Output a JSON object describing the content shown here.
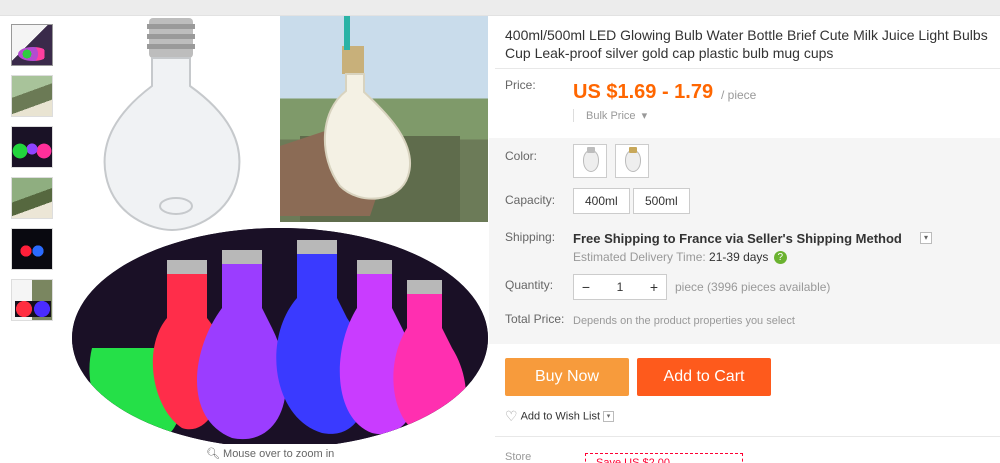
{
  "product": {
    "title": "400ml/500ml LED Glowing Bulb Water Bottle Brief Cute Milk Juice Light Bulbs Cup Leak-proof silver gold cap plastic bulb mug cups",
    "mouse_hint": "Mouse over to zoom in"
  },
  "price": {
    "label": "Price:",
    "value": "US $1.69 - 1.79",
    "unit": "/ piece",
    "bulk": "Bulk Price"
  },
  "color": {
    "label": "Color:"
  },
  "capacity": {
    "label": "Capacity:",
    "options": [
      "400ml",
      "500ml"
    ]
  },
  "shipping": {
    "label": "Shipping:",
    "main": "Free Shipping to France via Seller's Shipping Method",
    "estimate_prefix": "Estimated Delivery Time:",
    "estimate_days": "21-39 days"
  },
  "quantity": {
    "label": "Quantity:",
    "value": "1",
    "minus": "−",
    "plus": "+",
    "info": "piece (3996 pieces available)"
  },
  "total": {
    "label": "Total Price:",
    "info": "Depends on the product properties you select"
  },
  "actions": {
    "buy_now": "Buy Now",
    "add_to_cart": "Add to Cart",
    "wish_list": "Add to Wish List"
  },
  "store": {
    "label": "Store",
    "coupon": "Save US $2.00"
  },
  "colors": {
    "price": "#ff6600",
    "buy_now": "#f79b3c",
    "add_to_cart": "#fe5a1c"
  }
}
